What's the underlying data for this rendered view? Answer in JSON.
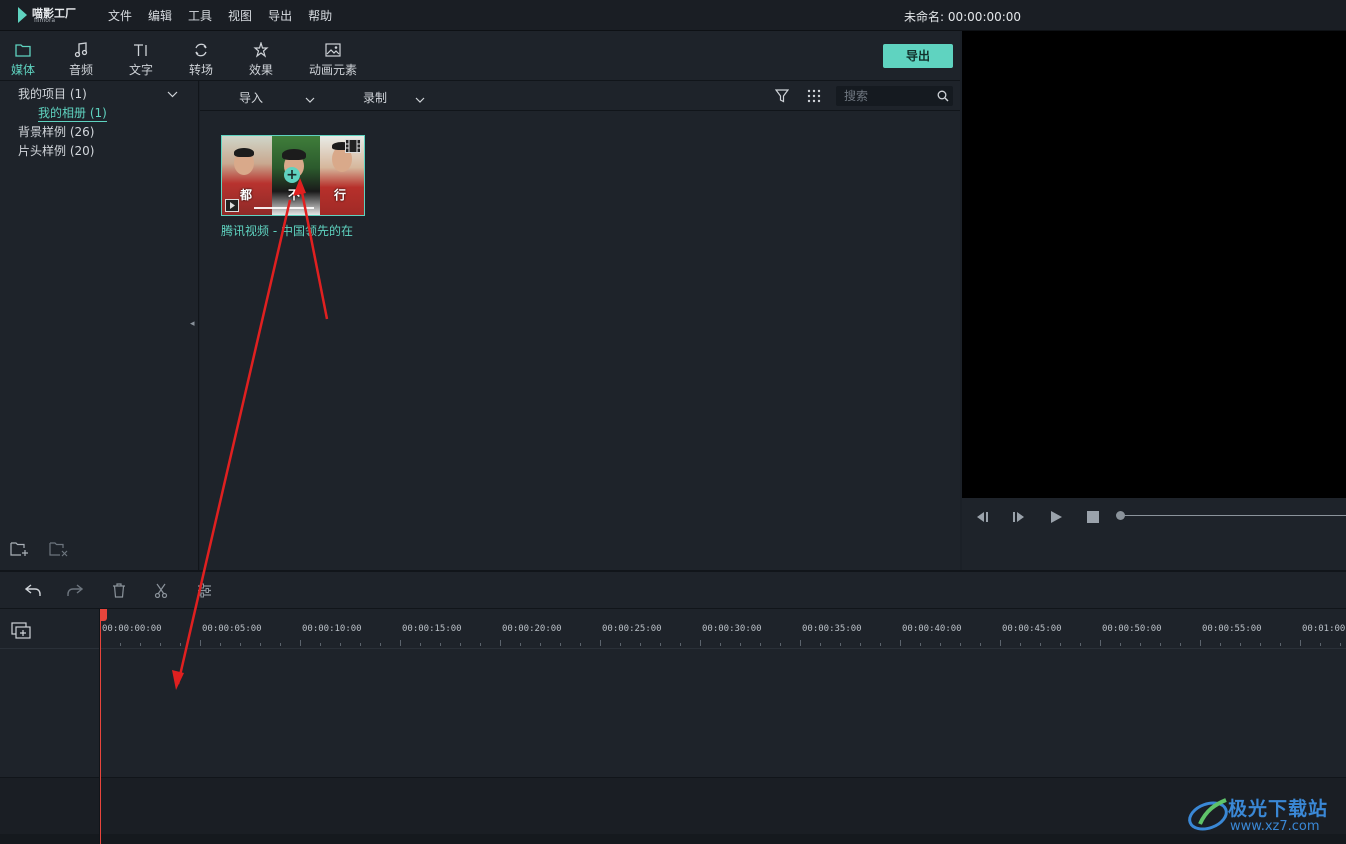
{
  "app": {
    "logo_name": "喵影工厂",
    "logo_sub": "filmora",
    "menu": [
      "文件",
      "编辑",
      "工具",
      "视图",
      "导出",
      "帮助"
    ],
    "project_title": "未命名: 00:00:00:00"
  },
  "tabs": [
    {
      "label": "媒体",
      "icon": "folder-icon",
      "active": true
    },
    {
      "label": "音频",
      "icon": "music-note-icon",
      "active": false
    },
    {
      "label": "文字",
      "icon": "text-icon",
      "active": false
    },
    {
      "label": "转场",
      "icon": "transition-icon",
      "active": false
    },
    {
      "label": "效果",
      "icon": "effects-icon",
      "active": false
    },
    {
      "label": "动画元素",
      "icon": "image-icon",
      "active": false
    }
  ],
  "export_label": "导出",
  "tree": {
    "project": "我的项目 (1)",
    "album": "我的相册 (1)",
    "bg_samples": "背景样例 (26)",
    "intro_samples": "片头样例 (20)"
  },
  "media_toolbar": {
    "import_label": "导入",
    "record_label": "录制",
    "search_placeholder": "搜索"
  },
  "clip": {
    "name": "腾讯视频 - 中国领先的在",
    "captions": [
      "都",
      "不",
      "行"
    ]
  },
  "timeline": {
    "labels": [
      "00:00:00:00",
      "00:00:05:00",
      "00:00:10:00",
      "00:00:15:00",
      "00:00:20:00",
      "00:00:25:00",
      "00:00:30:00",
      "00:00:35:00",
      "00:00:40:00",
      "00:00:45:00",
      "00:00:50:00",
      "00:00:55:00",
      "00:01:00:"
    ]
  },
  "watermark": {
    "text": "极光下载站",
    "url": "www.xz7.com"
  },
  "colors": {
    "accent": "#5fd3c0",
    "playhead": "#e8453c",
    "annotation_arrow": "#e02020"
  }
}
